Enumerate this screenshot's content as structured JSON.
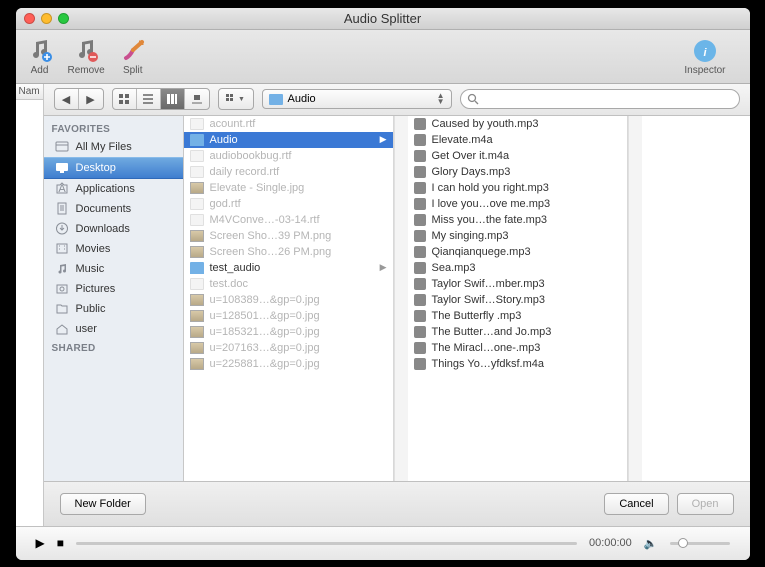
{
  "window": {
    "title": "Audio Splitter"
  },
  "toolbar": {
    "add": "Add",
    "remove": "Remove",
    "split": "Split",
    "inspector": "Inspector"
  },
  "name_col": "Nam",
  "finder": {
    "path_label": "Audio"
  },
  "sidebar": {
    "favorites_header": "FAVORITES",
    "shared_header": "SHARED",
    "items": [
      {
        "label": "All My Files",
        "icon": "all-my-files"
      },
      {
        "label": "Desktop",
        "icon": "desktop",
        "selected": true
      },
      {
        "label": "Applications",
        "icon": "applications"
      },
      {
        "label": "Documents",
        "icon": "documents"
      },
      {
        "label": "Downloads",
        "icon": "downloads"
      },
      {
        "label": "Movies",
        "icon": "movies"
      },
      {
        "label": "Music",
        "icon": "music"
      },
      {
        "label": "Pictures",
        "icon": "pictures"
      },
      {
        "label": "Public",
        "icon": "folder"
      },
      {
        "label": "user",
        "icon": "home"
      }
    ]
  },
  "col1": [
    {
      "label": "acount.rtf",
      "type": "doc",
      "dim": true
    },
    {
      "label": "Audio",
      "type": "folder",
      "selected": true,
      "arrow": true
    },
    {
      "label": "audiobookbug.rtf",
      "type": "doc",
      "dim": true
    },
    {
      "label": "daily record.rtf",
      "type": "doc",
      "dim": true
    },
    {
      "label": "Elevate - Single.jpg",
      "type": "img",
      "dim": true
    },
    {
      "label": "god.rtf",
      "type": "doc",
      "dim": true
    },
    {
      "label": "M4VConve…-03-14.rtf",
      "type": "doc",
      "dim": true
    },
    {
      "label": "Screen Sho…39 PM.png",
      "type": "img",
      "dim": true
    },
    {
      "label": "Screen Sho…26 PM.png",
      "type": "img",
      "dim": true
    },
    {
      "label": "test_audio",
      "type": "folder",
      "arrow": true
    },
    {
      "label": "test.doc",
      "type": "doc",
      "dim": true
    },
    {
      "label": "u=108389…&gp=0.jpg",
      "type": "img",
      "dim": true
    },
    {
      "label": "u=128501…&gp=0.jpg",
      "type": "img",
      "dim": true
    },
    {
      "label": "u=185321…&gp=0.jpg",
      "type": "img",
      "dim": true
    },
    {
      "label": "u=207163…&gp=0.jpg",
      "type": "img",
      "dim": true
    },
    {
      "label": "u=225881…&gp=0.jpg",
      "type": "img",
      "dim": true
    }
  ],
  "col2": [
    {
      "label": "Caused by youth.mp3"
    },
    {
      "label": "Elevate.m4a"
    },
    {
      "label": "Get Over it.m4a"
    },
    {
      "label": "Glory Days.mp3"
    },
    {
      "label": "I can hold you right.mp3"
    },
    {
      "label": "I love you…ove me.mp3"
    },
    {
      "label": "Miss you…the fate.mp3"
    },
    {
      "label": "My singing.mp3"
    },
    {
      "label": "Qianqianquege.mp3"
    },
    {
      "label": "Sea.mp3"
    },
    {
      "label": "Taylor Swif…mber.mp3"
    },
    {
      "label": "Taylor Swif…Story.mp3"
    },
    {
      "label": "The Butterfly .mp3"
    },
    {
      "label": "The Butter…and Jo.mp3"
    },
    {
      "label": "The Miracl…one-.mp3"
    },
    {
      "label": "Things Yo…yfdksf.m4a"
    }
  ],
  "buttons": {
    "new_folder": "New Folder",
    "cancel": "Cancel",
    "open": "Open"
  },
  "playbar": {
    "time": "00:00:00"
  }
}
